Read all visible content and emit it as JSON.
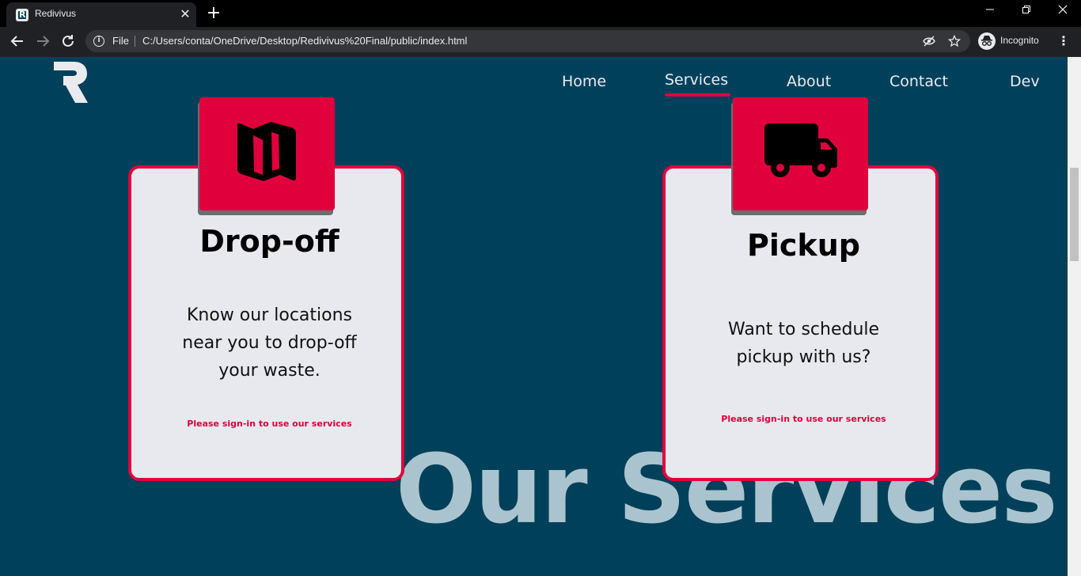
{
  "browser": {
    "tab_title": "Redivivus",
    "tab_close": "✕",
    "new_tab": "+",
    "scheme_label": "File",
    "url": "C:/Users/conta/OneDrive/Desktop/Redivivus%20Final/public/index.html",
    "incognito_label": "Incognito"
  },
  "nav": {
    "items": [
      "Home",
      "Services",
      "About",
      "Contact",
      "Dev"
    ],
    "active": "Services"
  },
  "background_title": "Our Services",
  "cards": [
    {
      "icon": "map-icon",
      "title": "Drop-off",
      "description_lines": [
        "Know our locations",
        "near you to drop-off",
        "your waste."
      ],
      "note": "Please sign-in to use our services"
    },
    {
      "icon": "truck-icon",
      "title": "Pickup",
      "description_lines": [
        "Want to schedule",
        "pickup with us?"
      ],
      "note": "Please sign-in to use our services"
    }
  ],
  "colors": {
    "page_background": "#00405a",
    "accent": "#e0003c",
    "card_background": "#e8e9ee",
    "background_title": "#aac4cf"
  }
}
